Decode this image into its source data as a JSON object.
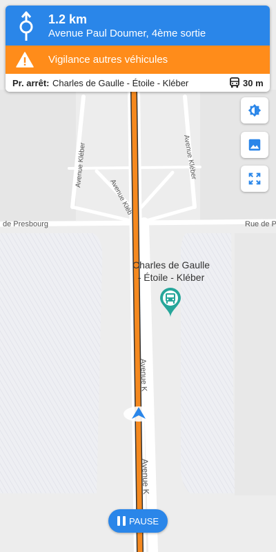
{
  "navigation": {
    "distance": "1.2 km",
    "street": "Avenue Paul Doumer, 4ème sortie",
    "maneuver_icon": "roundabout-exit-icon"
  },
  "warning": {
    "text": "Vigilance autres véhicules",
    "icon": "warning-triangle-icon",
    "color": "#ff8c1a"
  },
  "next_stop": {
    "prefix": "Pr. arrêt:",
    "name": "Charles de Gaulle - Étoile - Kléber",
    "distance": "30 m",
    "icon": "bus-icon"
  },
  "map": {
    "stop_label_line1": "Charles de Gaulle",
    "stop_label_line2": "- Étoile - Kléber",
    "street_labels": {
      "presbourg_left": "de Presbourg",
      "presbourg_right": "Rue de Pres",
      "kleber_left": "Avenue Kléber",
      "kleber_mid": "Avenue Kléb",
      "kleber_right": "Avenue Kléber",
      "kleber_route_upper": "Avenue K",
      "kleber_route_lower": "Avenue K"
    },
    "route_color": "#f5891f",
    "stop_marker_color": "#26a69a"
  },
  "controls": {
    "day_night_icon": "brightness-icon",
    "map_style_icon": "image-icon",
    "fullscreen_icon": "fullscreen-icon",
    "pause_label": "PAUSE",
    "accent": "#2a86e9"
  }
}
